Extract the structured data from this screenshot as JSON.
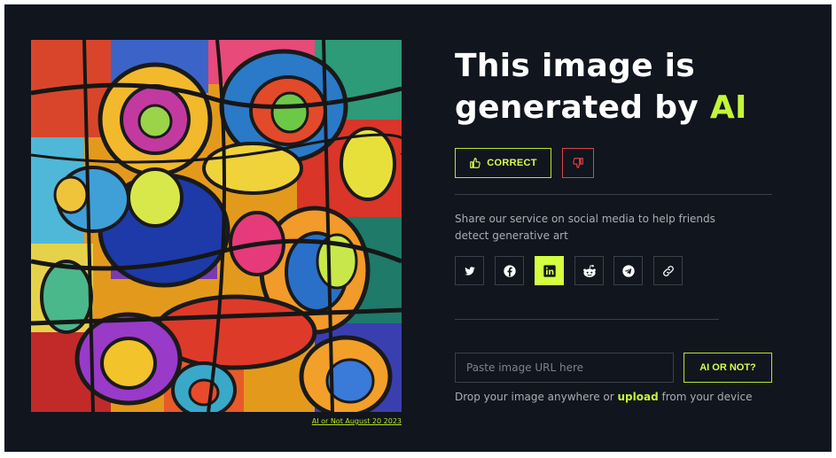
{
  "image": {
    "caption": "AI or Not August 20 2023",
    "alt": "abstract cubist colorful painting"
  },
  "result": {
    "title_prefix": "This image is generated by ",
    "title_highlight": "AI",
    "correct_label": "CORRECT",
    "thumbs_up_icon": "thumbs-up-icon",
    "thumbs_down_icon": "thumbs-down-icon"
  },
  "share": {
    "text": "Share our service on social media to help friends detect generative art",
    "buttons": [
      {
        "icon": "twitter-icon",
        "active": false
      },
      {
        "icon": "facebook-icon",
        "active": false
      },
      {
        "icon": "linkedin-icon",
        "active": true
      },
      {
        "icon": "reddit-icon",
        "active": false
      },
      {
        "icon": "telegram-icon",
        "active": false
      },
      {
        "icon": "link-icon",
        "active": false
      }
    ]
  },
  "upload": {
    "placeholder": "Paste image URL here",
    "value": "",
    "submit_label": "AI OR NOT?",
    "drop_prefix": "Drop your image anywhere or ",
    "drop_link": "upload",
    "drop_suffix": " from your device"
  },
  "colors": {
    "background": "#11151d",
    "accent": "#c3f53a",
    "danger": "#d8444a",
    "text_muted": "#a9adb4"
  }
}
